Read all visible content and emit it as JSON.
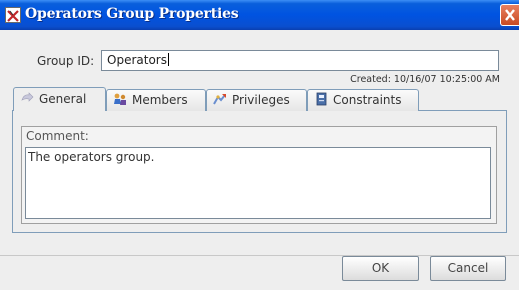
{
  "window": {
    "title": "Operators Group Properties"
  },
  "form": {
    "group_id_label": "Group ID:",
    "group_id_value": "Operators",
    "created_text": "Created: 10/16/07 10:25:00 AM"
  },
  "tabs": [
    {
      "label": "General",
      "selected": true
    },
    {
      "label": "Members",
      "selected": false
    },
    {
      "label": "Privileges",
      "selected": false
    },
    {
      "label": "Constraints",
      "selected": false
    }
  ],
  "general": {
    "comment_label": "Comment:",
    "comment_value": "The operators group."
  },
  "buttons": {
    "ok_label": "OK",
    "cancel_label": "Cancel"
  },
  "colors": {
    "titlebar": "#0053e1",
    "close": "#d0582f",
    "border": "#7f9db9"
  }
}
